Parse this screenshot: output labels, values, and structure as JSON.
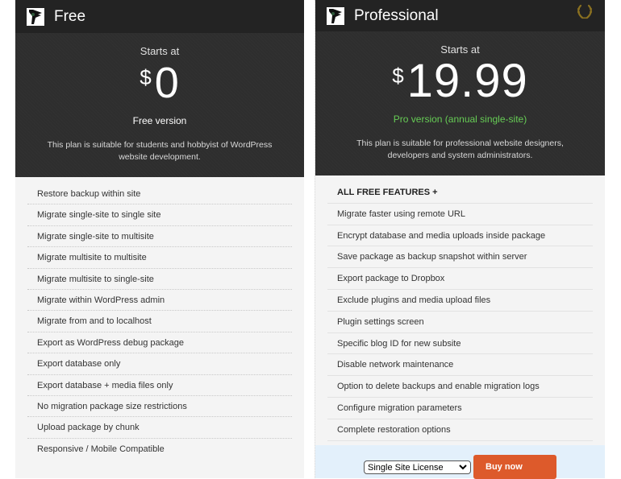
{
  "plans": {
    "free": {
      "name": "Free",
      "starts_label": "Starts at",
      "currency": "$",
      "price": "0",
      "version": "Free version",
      "description": "This plan is suitable for students and hobbyist of WordPress website development.",
      "features": [
        "Restore backup within site",
        "Migrate single-site to single site",
        "Migrate single-site to multisite",
        "Migrate multisite to multisite",
        "Migrate multisite to single-site",
        "Migrate within WordPress admin",
        "Migrate from and to localhost",
        "Export as WordPress debug package",
        "Export database only",
        "Export database + media files only",
        "No migration package size restrictions",
        "Upload package by chunk",
        "Responsive / Mobile Compatible"
      ]
    },
    "pro": {
      "name": "Professional",
      "badge_icon": "laurel-wreath-icon",
      "starts_label": "Starts at",
      "currency": "$",
      "price": "19.99",
      "version": "Pro version (annual single-site)",
      "version_color": "#66cc55",
      "description": "This plan is suitable for professional website designers, developers and system administrators.",
      "features": [
        "ALL FREE FEATURES +",
        "Migrate faster using remote URL",
        "Encrypt database and media uploads inside package",
        "Save package as backup snapshot within server",
        "Export package to Dropbox",
        "Exclude plugins and media upload files",
        "Plugin settings screen",
        "Specific blog ID for new subsite",
        "Disable network maintenance",
        "Option to delete backups and enable migration logs",
        "Configure migration parameters",
        "Complete restoration options"
      ],
      "license_select": {
        "selected": "Single Site License"
      },
      "buy_label": "Buy now",
      "buy_color": "#dd5a2b"
    }
  }
}
